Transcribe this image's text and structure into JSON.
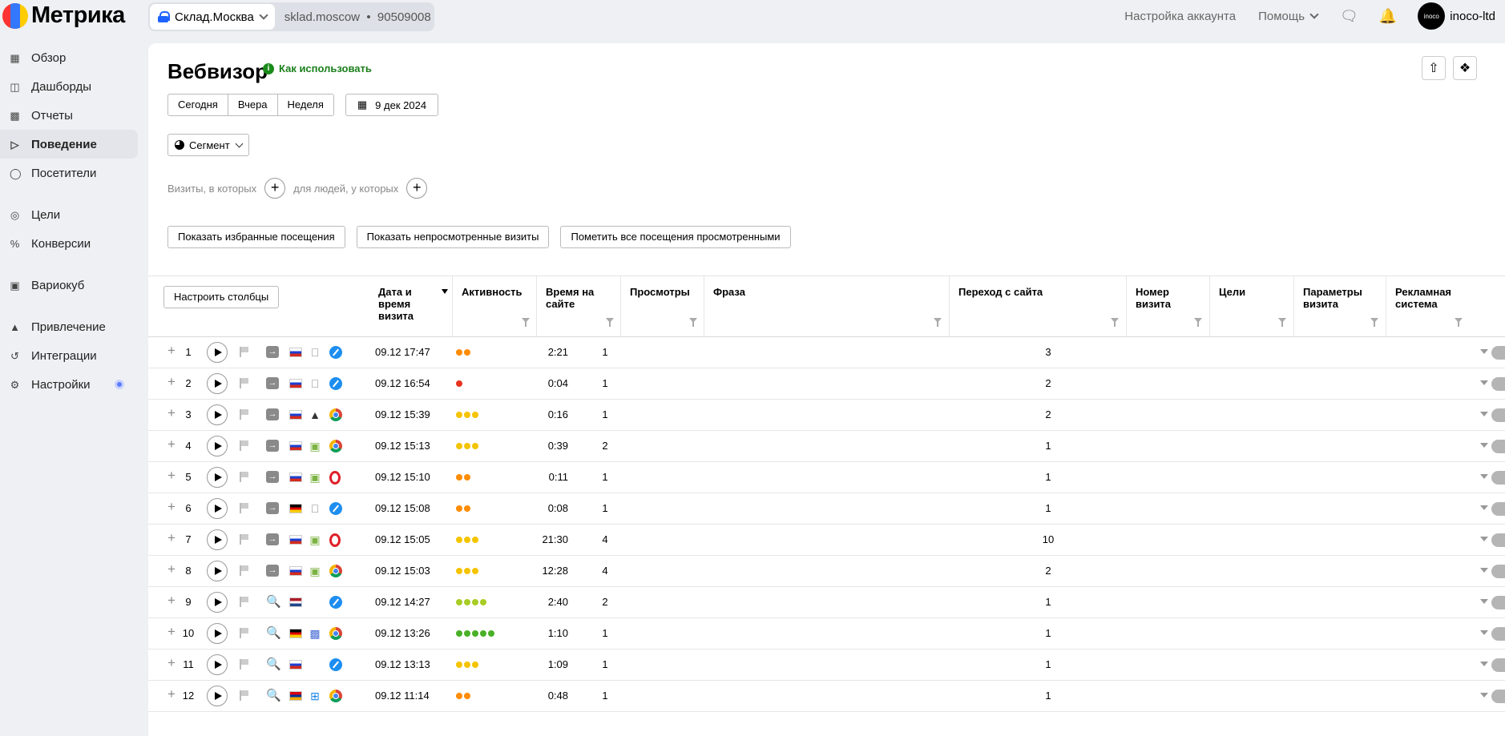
{
  "app": {
    "logo_text": "Метрика",
    "counter_name": "Склад.Москва",
    "counter_host": "sklad.moscow",
    "counter_id": "90509008"
  },
  "header": {
    "account_settings": "Настройка аккаунта",
    "help": "Помощь",
    "org_name": "inoco-ltd",
    "avatar_text": "inoco"
  },
  "sidebar": {
    "items": [
      {
        "label": "Обзор",
        "icon": "grid-icon"
      },
      {
        "label": "Дашборды",
        "icon": "dashboard-icon"
      },
      {
        "label": "Отчеты",
        "icon": "bar-chart-icon"
      },
      {
        "label": "Поведение",
        "icon": "play-outline-icon"
      },
      {
        "label": "Посетители",
        "icon": "person-icon"
      },
      {
        "label": "Цели",
        "icon": "target-icon"
      },
      {
        "label": "Конверсии",
        "icon": "percent-icon"
      },
      {
        "label": "Вариокуб",
        "icon": "cube-icon"
      },
      {
        "label": "Привлечение",
        "icon": "flame-icon"
      },
      {
        "label": "Интеграции",
        "icon": "integrations-icon"
      },
      {
        "label": "Настройки",
        "icon": "gear-icon"
      }
    ]
  },
  "page": {
    "title": "Вебвизор",
    "howto": "Как использовать",
    "periods": [
      "Сегодня",
      "Вчера",
      "Неделя"
    ],
    "date": "9 дек 2024",
    "segment": "Сегмент",
    "filter_visits": "Визиты, в которых",
    "filter_people": "для людей, у которых",
    "actions": {
      "favorites": "Показать избранные посещения",
      "unviewed": "Показать непросмотренные визиты",
      "mark_all": "Пометить все посещения просмотренными"
    }
  },
  "table": {
    "configure": "Настроить столбцы",
    "columns": {
      "datetime": "Дата и время визита",
      "activity": "Активность",
      "time_on_site": "Время на сайте",
      "views": "Просмотры",
      "phrase": "Фраза",
      "referrer": "Переход с сайта",
      "visit_number": "Номер визита",
      "goals": "Цели",
      "visit_params": "Параметры визита",
      "ad_system": "Рекламная система"
    },
    "colors": {
      "orange": "#ff8c00",
      "red": "#e8321e",
      "yellow": "#f5c400",
      "lime": "#a8cc24",
      "green": "#48b028"
    },
    "rows": [
      {
        "n": "1",
        "source": "direct",
        "country": "ru",
        "os": "apple",
        "browser": "safari",
        "datetime": "09.12 17:47",
        "activity": [
          "orange",
          "orange"
        ],
        "time": "2:21",
        "views": "1",
        "visit_number": "3"
      },
      {
        "n": "2",
        "source": "direct",
        "country": "ru",
        "os": "apple",
        "browser": "safari",
        "datetime": "09.12 16:54",
        "activity": [
          "red"
        ],
        "time": "0:04",
        "views": "1",
        "visit_number": "2"
      },
      {
        "n": "3",
        "source": "direct",
        "country": "ru",
        "os": "linux",
        "browser": "chrome",
        "datetime": "09.12 15:39",
        "activity": [
          "yellow",
          "yellow",
          "yellow"
        ],
        "time": "0:16",
        "views": "1",
        "visit_number": "2"
      },
      {
        "n": "4",
        "source": "direct",
        "country": "ru",
        "os": "android",
        "browser": "chrome",
        "datetime": "09.12 15:13",
        "activity": [
          "yellow",
          "yellow",
          "yellow"
        ],
        "time": "0:39",
        "views": "2",
        "visit_number": "1"
      },
      {
        "n": "5",
        "source": "direct",
        "country": "ru",
        "os": "android",
        "browser": "opera",
        "datetime": "09.12 15:10",
        "activity": [
          "orange",
          "orange"
        ],
        "time": "0:11",
        "views": "1",
        "visit_number": "1"
      },
      {
        "n": "6",
        "source": "direct",
        "country": "de",
        "os": "apple",
        "browser": "safari",
        "datetime": "09.12 15:08",
        "activity": [
          "orange",
          "orange"
        ],
        "time": "0:08",
        "views": "1",
        "visit_number": "1"
      },
      {
        "n": "7",
        "source": "direct",
        "country": "ru",
        "os": "android",
        "browser": "opera",
        "datetime": "09.12 15:05",
        "activity": [
          "yellow",
          "yellow",
          "yellow"
        ],
        "time": "21:30",
        "views": "4",
        "visit_number": "10"
      },
      {
        "n": "8",
        "source": "direct",
        "country": "ru",
        "os": "android",
        "browser": "chrome",
        "datetime": "09.12 15:03",
        "activity": [
          "yellow",
          "yellow",
          "yellow"
        ],
        "time": "12:28",
        "views": "4",
        "visit_number": "2"
      },
      {
        "n": "9",
        "source": "search",
        "country": "nl",
        "os": "",
        "browser": "safari",
        "datetime": "09.12 14:27",
        "activity": [
          "lime",
          "lime",
          "lime",
          "lime"
        ],
        "time": "2:40",
        "views": "2",
        "visit_number": "1"
      },
      {
        "n": "10",
        "source": "search",
        "country": "de",
        "os": "mac",
        "browser": "chrome",
        "datetime": "09.12 13:26",
        "activity": [
          "green",
          "green",
          "green",
          "green",
          "green"
        ],
        "time": "1:10",
        "views": "1",
        "visit_number": "1"
      },
      {
        "n": "11",
        "source": "search",
        "country": "ru",
        "os": "",
        "browser": "safari",
        "datetime": "09.12 13:13",
        "activity": [
          "yellow",
          "yellow",
          "yellow"
        ],
        "time": "1:09",
        "views": "1",
        "visit_number": "1"
      },
      {
        "n": "12",
        "source": "search",
        "country": "am",
        "os": "windows",
        "browser": "chrome",
        "datetime": "09.12 11:14",
        "activity": [
          "orange",
          "orange"
        ],
        "time": "0:48",
        "views": "1",
        "visit_number": "1"
      }
    ]
  }
}
